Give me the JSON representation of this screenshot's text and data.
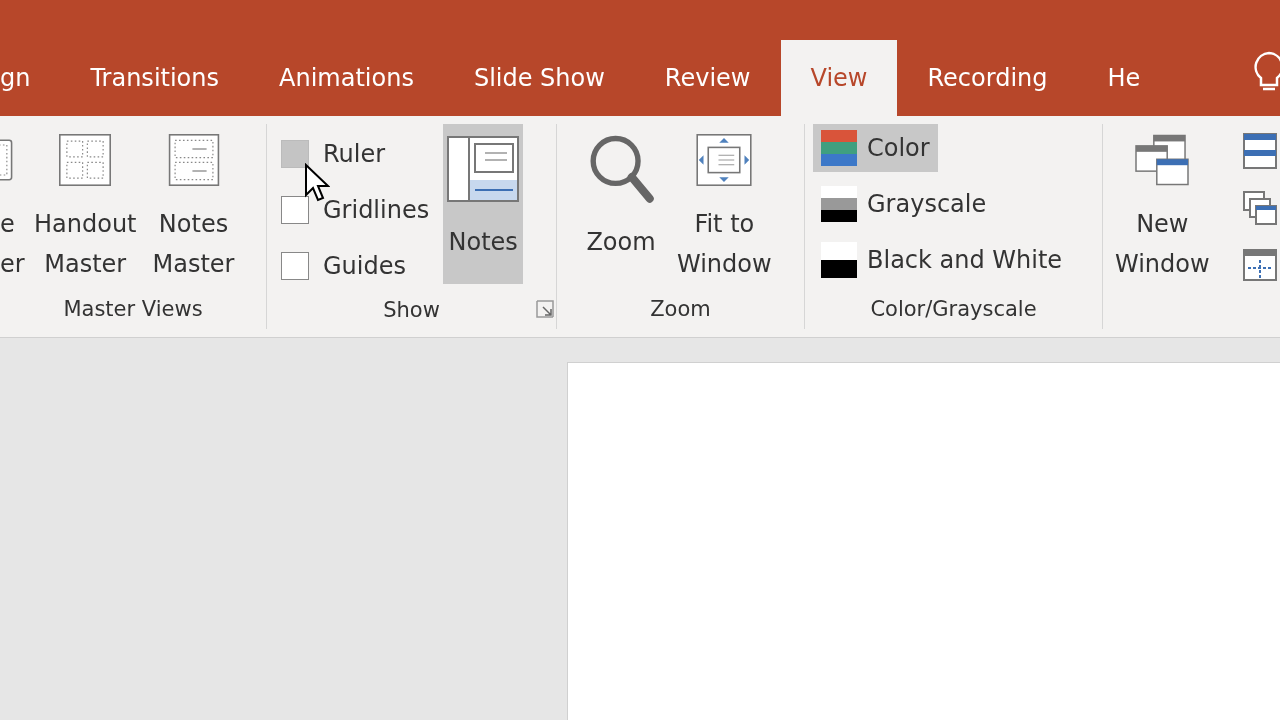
{
  "tabs": [
    {
      "label": "gn",
      "selected": false
    },
    {
      "label": "Transitions",
      "selected": false
    },
    {
      "label": "Animations",
      "selected": false
    },
    {
      "label": "Slide Show",
      "selected": false
    },
    {
      "label": "Review",
      "selected": false
    },
    {
      "label": "View",
      "selected": true
    },
    {
      "label": "Recording",
      "selected": false
    },
    {
      "label": "He",
      "selected": false
    }
  ],
  "groups": [
    {
      "kind": "buttons",
      "label": "Master Views",
      "buttons": [
        {
          "kind": "slide-master",
          "lines": [
            "e",
            "er"
          ],
          "selected": false
        },
        {
          "kind": "handout",
          "lines": [
            "Handout",
            "Master"
          ],
          "selected": false
        },
        {
          "kind": "notes-master",
          "lines": [
            "Notes",
            "Master"
          ],
          "selected": false
        }
      ]
    },
    {
      "kind": "show",
      "label": "Show",
      "checkboxes": [
        {
          "label": "Ruler",
          "checked": false,
          "hovered": true
        },
        {
          "label": "Gridlines",
          "checked": false,
          "hovered": false
        },
        {
          "label": "Guides",
          "checked": false,
          "hovered": false
        }
      ],
      "buttons": [
        {
          "kind": "notes",
          "lines": [
            "Notes"
          ],
          "selected": true
        }
      ]
    },
    {
      "kind": "buttons",
      "label": "Zoom",
      "buttons": [
        {
          "kind": "zoom",
          "lines": [
            "Zoom"
          ],
          "selected": false
        },
        {
          "kind": "fit",
          "lines": [
            "Fit to",
            "Window"
          ],
          "selected": false
        }
      ]
    },
    {
      "kind": "options",
      "label": "Color/Grayscale",
      "options": [
        {
          "kind": "color",
          "label": "Color",
          "selected": true
        },
        {
          "kind": "grayscale",
          "label": "Grayscale",
          "selected": false
        },
        {
          "kind": "bw",
          "label": "Black and White",
          "selected": false
        }
      ]
    },
    {
      "kind": "window",
      "buttons": [
        {
          "kind": "new-window",
          "lines": [
            "New",
            "Window"
          ],
          "selected": false
        }
      ]
    }
  ]
}
